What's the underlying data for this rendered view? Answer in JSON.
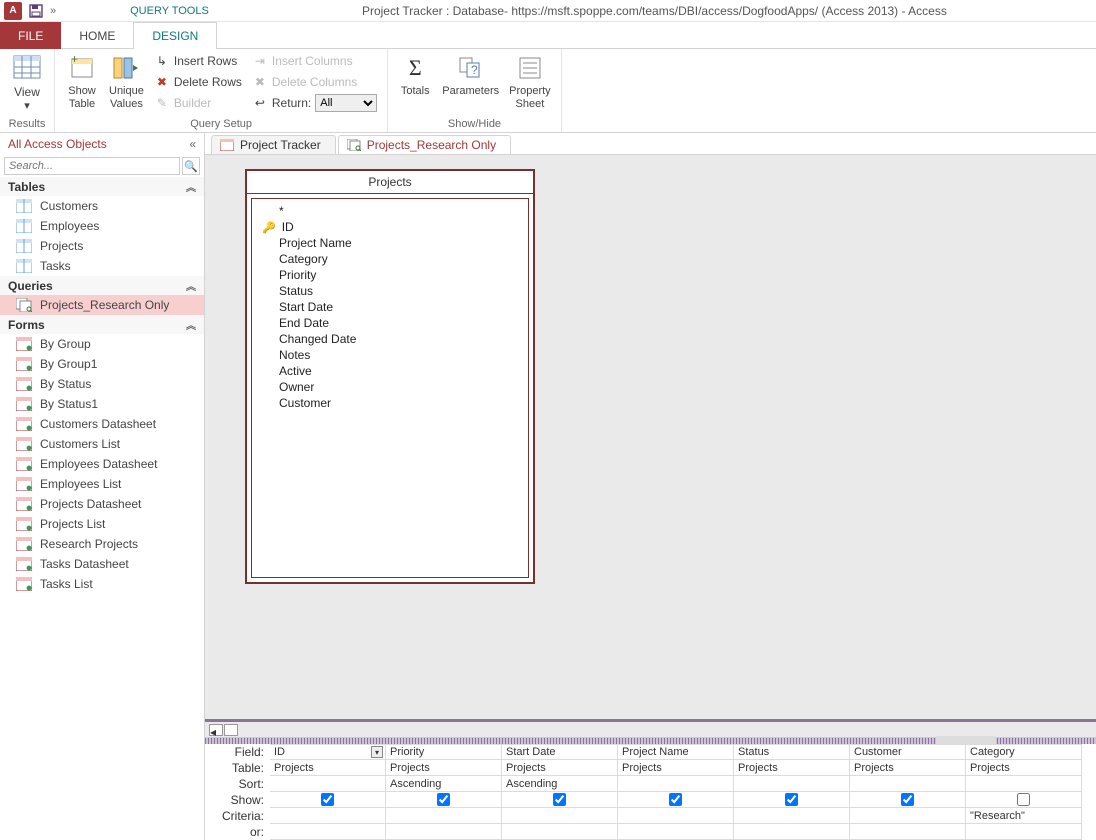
{
  "title": "Project Tracker : Database- https://msft.spoppe.com/teams/DBI/access/DogfoodApps/ (Access 2013) - Access",
  "tool_tab": "QUERY TOOLS",
  "tabs": {
    "file": "FILE",
    "home": "HOME",
    "design": "DESIGN"
  },
  "ribbon": {
    "results": {
      "label": "Results",
      "view": "View"
    },
    "querysetup": {
      "label": "Query Setup",
      "show_table": "Show\nTable",
      "unique_values": "Unique\nValues",
      "insert_rows": "Insert Rows",
      "delete_rows": "Delete Rows",
      "builder": "Builder",
      "insert_columns": "Insert Columns",
      "delete_columns": "Delete Columns",
      "return": "Return:",
      "return_value": "All"
    },
    "showhide": {
      "label": "Show/Hide",
      "totals": "Totals",
      "parameters": "Parameters",
      "property_sheet": "Property\nSheet"
    }
  },
  "nav": {
    "title": "All Access Objects",
    "search_placeholder": "Search...",
    "sections": {
      "tables": "Tables",
      "queries": "Queries",
      "forms": "Forms"
    },
    "tables": [
      "Customers",
      "Employees",
      "Projects",
      "Tasks"
    ],
    "queries": [
      "Projects_Research Only"
    ],
    "forms": [
      "By Group",
      "By Group1",
      "By Status",
      "By Status1",
      "Customers Datasheet",
      "Customers List",
      "Employees Datasheet",
      "Employees List",
      "Projects Datasheet",
      "Projects List",
      "Research Projects",
      "Tasks Datasheet",
      "Tasks List"
    ]
  },
  "doc_tabs": {
    "tab1": "Project Tracker",
    "tab2": "Projects_Research Only"
  },
  "tablebox": {
    "title": "Projects",
    "fields": [
      "*",
      "ID",
      "Project Name",
      "Category",
      "Priority",
      "Status",
      "Start Date",
      "End Date",
      "Changed Date",
      "Notes",
      "Active",
      "Owner",
      "Customer"
    ]
  },
  "qbe": {
    "labels": {
      "field": "Field:",
      "table": "Table:",
      "sort": "Sort:",
      "show": "Show:",
      "criteria": "Criteria:",
      "or": "or:"
    },
    "cols": [
      {
        "field": "ID",
        "table": "Projects",
        "sort": "",
        "show": true,
        "criteria": "",
        "dd": true
      },
      {
        "field": "Priority",
        "table": "Projects",
        "sort": "Ascending",
        "show": true,
        "criteria": ""
      },
      {
        "field": "Start Date",
        "table": "Projects",
        "sort": "Ascending",
        "show": true,
        "criteria": ""
      },
      {
        "field": "Project Name",
        "table": "Projects",
        "sort": "",
        "show": true,
        "criteria": ""
      },
      {
        "field": "Status",
        "table": "Projects",
        "sort": "",
        "show": true,
        "criteria": ""
      },
      {
        "field": "Customer",
        "table": "Projects",
        "sort": "",
        "show": true,
        "criteria": ""
      },
      {
        "field": "Category",
        "table": "Projects",
        "sort": "",
        "show": false,
        "criteria": "\"Research\""
      }
    ]
  }
}
